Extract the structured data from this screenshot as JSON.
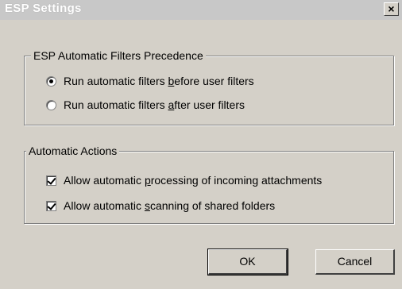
{
  "window": {
    "title": "ESP Settings",
    "close_glyph": "×"
  },
  "precedence": {
    "legend": "ESP Automatic Filters Precedence",
    "options": [
      {
        "pre": "Run automatic filters ",
        "accel": "b",
        "post": "efore user filters",
        "selected": true
      },
      {
        "pre": "Run automatic filters ",
        "accel": "a",
        "post": "fter user filters",
        "selected": false
      }
    ]
  },
  "actions": {
    "legend": "Automatic Actions",
    "items": [
      {
        "pre": "Allow automatic ",
        "accel": "p",
        "post": "rocessing of incoming attachments",
        "checked": true
      },
      {
        "pre": "Allow automatic ",
        "accel": "s",
        "post": "canning of shared folders",
        "checked": true
      }
    ]
  },
  "buttons": {
    "ok": "OK",
    "cancel": "Cancel"
  }
}
